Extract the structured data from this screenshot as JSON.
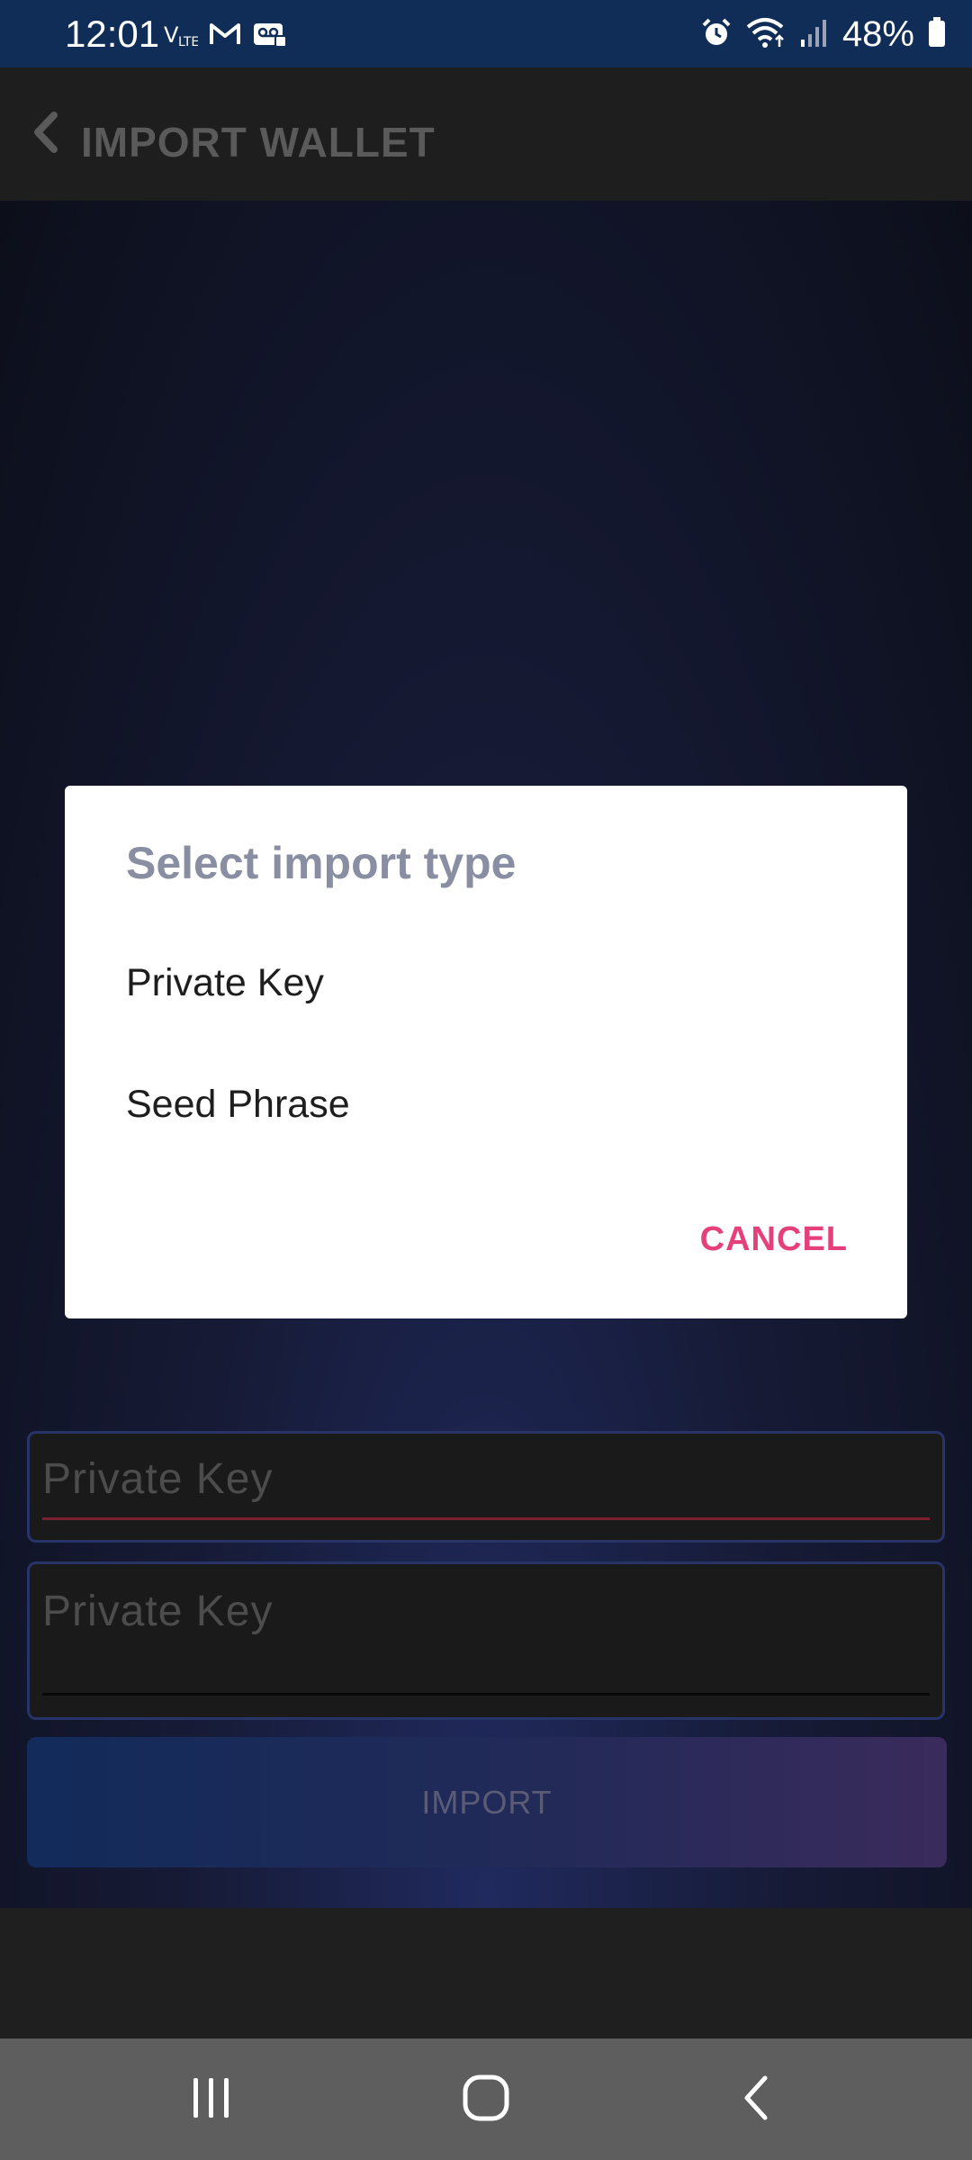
{
  "status_bar": {
    "time": "12:01",
    "battery_percent": "48%",
    "left_icons": [
      "volte-icon",
      "gmail-icon",
      "voicemail-icon"
    ],
    "right_icons": [
      "alarm-icon",
      "wifi-icon",
      "signal-icon",
      "battery-icon"
    ]
  },
  "header": {
    "back_icon": "chevron-left-icon",
    "title": "IMPORT WALLET"
  },
  "form": {
    "field_1_placeholder": "Private Key",
    "field_2_placeholder": "Private Key",
    "import_label": "IMPORT"
  },
  "dialog": {
    "title": "Select import type",
    "options": [
      {
        "label": "Private Key"
      },
      {
        "label": "Seed Phrase"
      }
    ],
    "cancel_label": "CANCEL"
  },
  "nav_bar": {
    "icons": [
      "recent-apps-icon",
      "home-icon",
      "back-icon"
    ]
  },
  "colors": {
    "status_bar": "#0f2d57",
    "accent_pink": "#e5407a",
    "dialog_title": "#8a8ea2",
    "nav_bar": "#5e5e5e"
  }
}
